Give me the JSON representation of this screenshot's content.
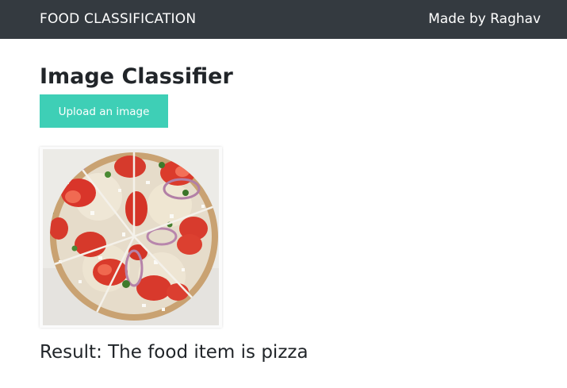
{
  "navbar": {
    "brand": "FOOD CLASSIFICATION",
    "credit": "Made by Raghav",
    "background": "#343a40"
  },
  "main": {
    "title": "Image Classifier",
    "upload_button_label": "Upload an image",
    "upload_button_color": "#3ecfb6",
    "image_subject": "pizza",
    "result_text": "Result: The food item is pizza"
  }
}
